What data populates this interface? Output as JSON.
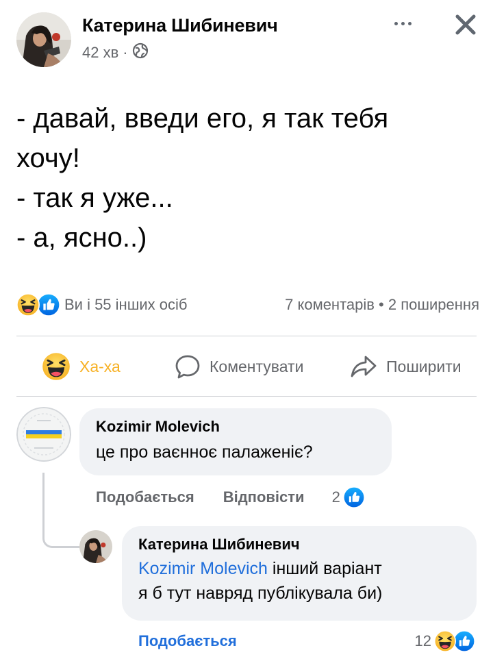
{
  "post": {
    "author": "Катерина Шибиневич",
    "time": "42 хв",
    "separator": "·",
    "privacy_icon": "globe-icon",
    "lines": [
      "- давай, введи его, я так тебя",
      "хочу!",
      "- так я уже...",
      "- а, ясно..)"
    ]
  },
  "header": {
    "more_icon": "more-options-icon",
    "close_icon": "close-icon"
  },
  "reactions": {
    "summary": "Ви і 55 інших осіб",
    "counts": "7 коментарів • 2 поширення",
    "icons": [
      "haha-reaction-icon",
      "like-reaction-icon"
    ]
  },
  "actions": {
    "haha": "Ха-ха",
    "comment": "Коментувати",
    "share": "Поширити"
  },
  "comments": [
    {
      "author": "Kozimir Molevich",
      "text": "це про ваєнноє палаженіє?",
      "like_label": "Подобається",
      "reply_label": "Відповісти",
      "reaction_count": "2"
    }
  ],
  "reply": {
    "author": "Катерина Шибиневич",
    "mention": "Kozimir Molevich",
    "text_line1": " інший варіант",
    "text_line2": "я б тут навряд публікувала би)",
    "like_label": "Подобається",
    "reaction_count": "12"
  },
  "colors": {
    "accent_blue": "#216fdb",
    "haha_yellow": "#f7b125",
    "secondary_text": "#65676b",
    "bubble_bg": "#f0f2f5"
  }
}
